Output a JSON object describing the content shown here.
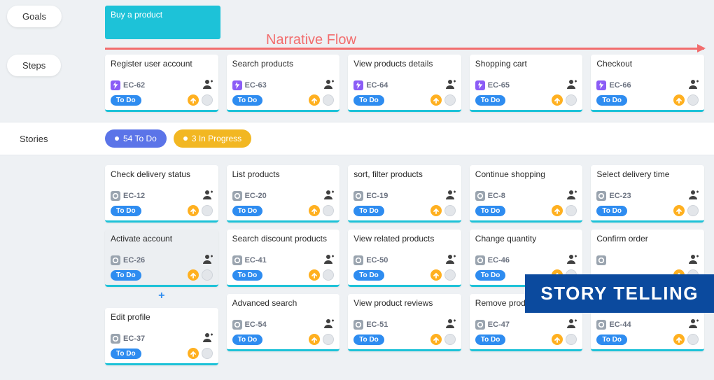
{
  "labels": {
    "goals": "Goals",
    "steps": "Steps",
    "stories": "Stories",
    "narrative": "Narrative Flow",
    "plus": "+"
  },
  "overlay": "STORY TELLING",
  "goal": {
    "title": "Buy a product"
  },
  "filters": {
    "todo": "54 To Do",
    "inprogress": "3 In Progress"
  },
  "steps": [
    {
      "title": "Register user account",
      "id": "EC-62",
      "status": "To Do"
    },
    {
      "title": "Search products",
      "id": "EC-63",
      "status": "To Do"
    },
    {
      "title": "View products details",
      "id": "EC-64",
      "status": "To Do"
    },
    {
      "title": "Shopping cart",
      "id": "EC-65",
      "status": "To Do"
    },
    {
      "title": "Checkout",
      "id": "EC-66",
      "status": "To Do"
    }
  ],
  "story_rows": [
    [
      {
        "title": "Check delivery status",
        "id": "EC-12",
        "status": "To Do"
      },
      {
        "title": "List products",
        "id": "EC-20",
        "status": "To Do"
      },
      {
        "title": "sort, filter products",
        "id": "EC-19",
        "status": "To Do"
      },
      {
        "title": "Continue shopping",
        "id": "EC-8",
        "status": "To Do"
      },
      {
        "title": "Select delivery time",
        "id": "EC-23",
        "status": "To Do"
      }
    ],
    [
      {
        "title": "Activate account",
        "id": "EC-26",
        "status": "To Do",
        "active": true
      },
      {
        "title": "Search discount products",
        "id": "EC-41",
        "status": "To Do"
      },
      {
        "title": "View related products",
        "id": "EC-50",
        "status": "To Do"
      },
      {
        "title": "Change quantity",
        "id": "EC-46",
        "status": "To Do"
      },
      {
        "title": "Confirm order",
        "id": "",
        "status": ""
      }
    ],
    [
      {
        "title": "Edit profile",
        "id": "EC-37",
        "status": "To Do"
      },
      {
        "title": "Advanced search",
        "id": "EC-54",
        "status": "To Do"
      },
      {
        "title": "View product reviews",
        "id": "EC-51",
        "status": "To Do"
      },
      {
        "title": "Remove product",
        "id": "EC-47",
        "status": "To Do"
      },
      {
        "title": "",
        "id": "EC-44",
        "status": "To Do"
      }
    ]
  ]
}
